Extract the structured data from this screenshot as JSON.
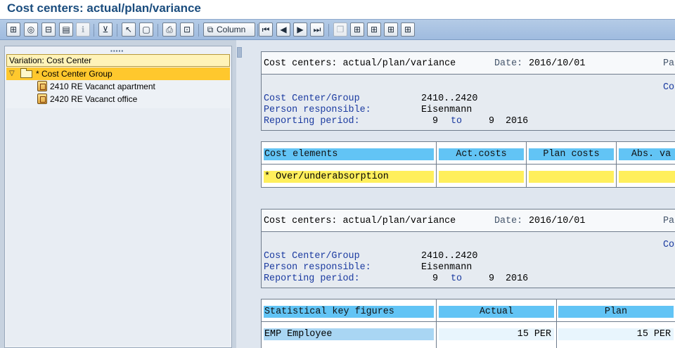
{
  "window": {
    "title": "Cost centers: actual/plan/variance"
  },
  "toolbar": {
    "buttons": [
      {
        "icon": "hierarchy-icon",
        "glyph": "⊞",
        "enabled": true
      },
      {
        "icon": "globe-icon",
        "glyph": "◎",
        "enabled": true
      },
      {
        "icon": "expand-tree-icon",
        "glyph": "⊟",
        "enabled": true
      },
      {
        "icon": "layout-icon",
        "glyph": "▤",
        "enabled": true
      },
      {
        "icon": "info-icon",
        "glyph": "ℹ",
        "enabled": false
      },
      {
        "icon": "filter-icon",
        "glyph": "⊻",
        "enabled": true
      },
      {
        "icon": "select-cursor-icon",
        "glyph": "↖",
        "enabled": true
      },
      {
        "icon": "window-icon",
        "glyph": "▢",
        "enabled": true
      },
      {
        "icon": "print-icon",
        "glyph": "⎙",
        "enabled": true
      },
      {
        "icon": "print-preview-icon",
        "glyph": "⊡",
        "enabled": true
      }
    ],
    "column_button": {
      "icon": "binoculars-icon",
      "glyph": "⧉",
      "label": "Column"
    },
    "nav_buttons": [
      {
        "icon": "first-page-icon",
        "glyph": "⏮"
      },
      {
        "icon": "previous-page-icon",
        "glyph": "◀"
      },
      {
        "icon": "next-page-icon",
        "glyph": "▶"
      },
      {
        "icon": "last-page-icon",
        "glyph": "⏭"
      }
    ],
    "extra_buttons": [
      {
        "icon": "copy-icon",
        "glyph": "❐",
        "enabled": false
      },
      {
        "icon": "structure-icon",
        "glyph": "⊞",
        "enabled": true
      },
      {
        "icon": "structure-down-icon",
        "glyph": "⊞",
        "enabled": true
      },
      {
        "icon": "structure-link-icon",
        "glyph": "⊞",
        "enabled": true
      },
      {
        "icon": "structure-alt-icon",
        "glyph": "⊞",
        "enabled": true
      }
    ]
  },
  "tree": {
    "header": "Variation: Cost Center",
    "group": {
      "label": "* Cost Center Group"
    },
    "items": [
      {
        "label": "2410 RE Vacanct apartment"
      },
      {
        "label": "2420 RE Vacanct office"
      }
    ]
  },
  "report_1": {
    "title": "Cost centers: actual/plan/variance",
    "date_label": "Date:",
    "date_value": "2016/10/01",
    "page_label": "Pa",
    "co_label": "Co",
    "cost_center_group_label": "Cost Center/Group",
    "cost_center_group_value": "2410..2420",
    "person_label": "Person responsible:",
    "person_value": "Eisenmann",
    "period_label": "Reporting period:",
    "period_from": "9",
    "period_to_label": "to",
    "period_to": "9",
    "period_year": "2016"
  },
  "table_1": {
    "columns": [
      "Cost elements",
      "Act.costs",
      "Plan costs",
      "Abs. va"
    ],
    "rows": [
      {
        "label": "* Over/underabsorption",
        "values": [
          "",
          "",
          ""
        ]
      }
    ]
  },
  "report_2": {
    "title": "Cost centers: actual/plan/variance",
    "date_label": "Date:",
    "date_value": "2016/10/01",
    "page_label": "Pa",
    "co_label": "Co",
    "cost_center_group_label": "Cost Center/Group",
    "cost_center_group_value": "2410..2420",
    "person_label": "Person responsible:",
    "person_value": "Eisenmann",
    "period_label": "Reporting period:",
    "period_from": "9",
    "period_to_label": "to",
    "period_to": "9",
    "period_year": "2016"
  },
  "table_2": {
    "columns": [
      "Statistical key figures",
      "Actual",
      "Plan"
    ],
    "rows": [
      {
        "label": "EMP  Employee",
        "actual": "15  PER",
        "plan": "15  PER"
      }
    ]
  }
}
